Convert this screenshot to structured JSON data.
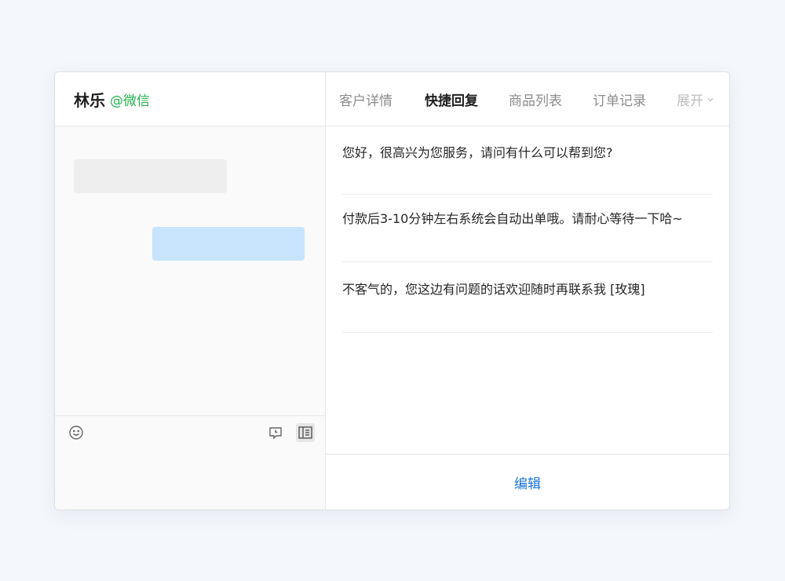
{
  "contact": {
    "name": "林乐",
    "channel": "@微信"
  },
  "tabs": [
    {
      "label": "客户详情",
      "active": false
    },
    {
      "label": "快捷回复",
      "active": true
    },
    {
      "label": "商品列表",
      "active": false
    },
    {
      "label": "订单记录",
      "active": false
    }
  ],
  "tabs_more": {
    "label": "展开",
    "icon": "chevron-down-icon"
  },
  "quick_replies": [
    {
      "text": "您好，很高兴为您服务，请问有什么可以帮到您?"
    },
    {
      "text": "付款后3-10分钟左右系统会自动出单哦。请耐心等待一下哈~"
    },
    {
      "text": "不客气的，您这边有问题的话欢迎随时再联系我 [玫瑰]"
    }
  ],
  "footer": {
    "edit_label": "编辑"
  },
  "composer": {
    "tools": [
      "smile-icon",
      "clock-message-icon",
      "side-panel-icon"
    ]
  },
  "colors": {
    "channel_green": "#21b24d",
    "link_blue": "#1a73d9",
    "outgoing_bubble": "#c8e4fc",
    "incoming_bubble": "#eeeeee",
    "page_background": "#f4f7fb"
  }
}
